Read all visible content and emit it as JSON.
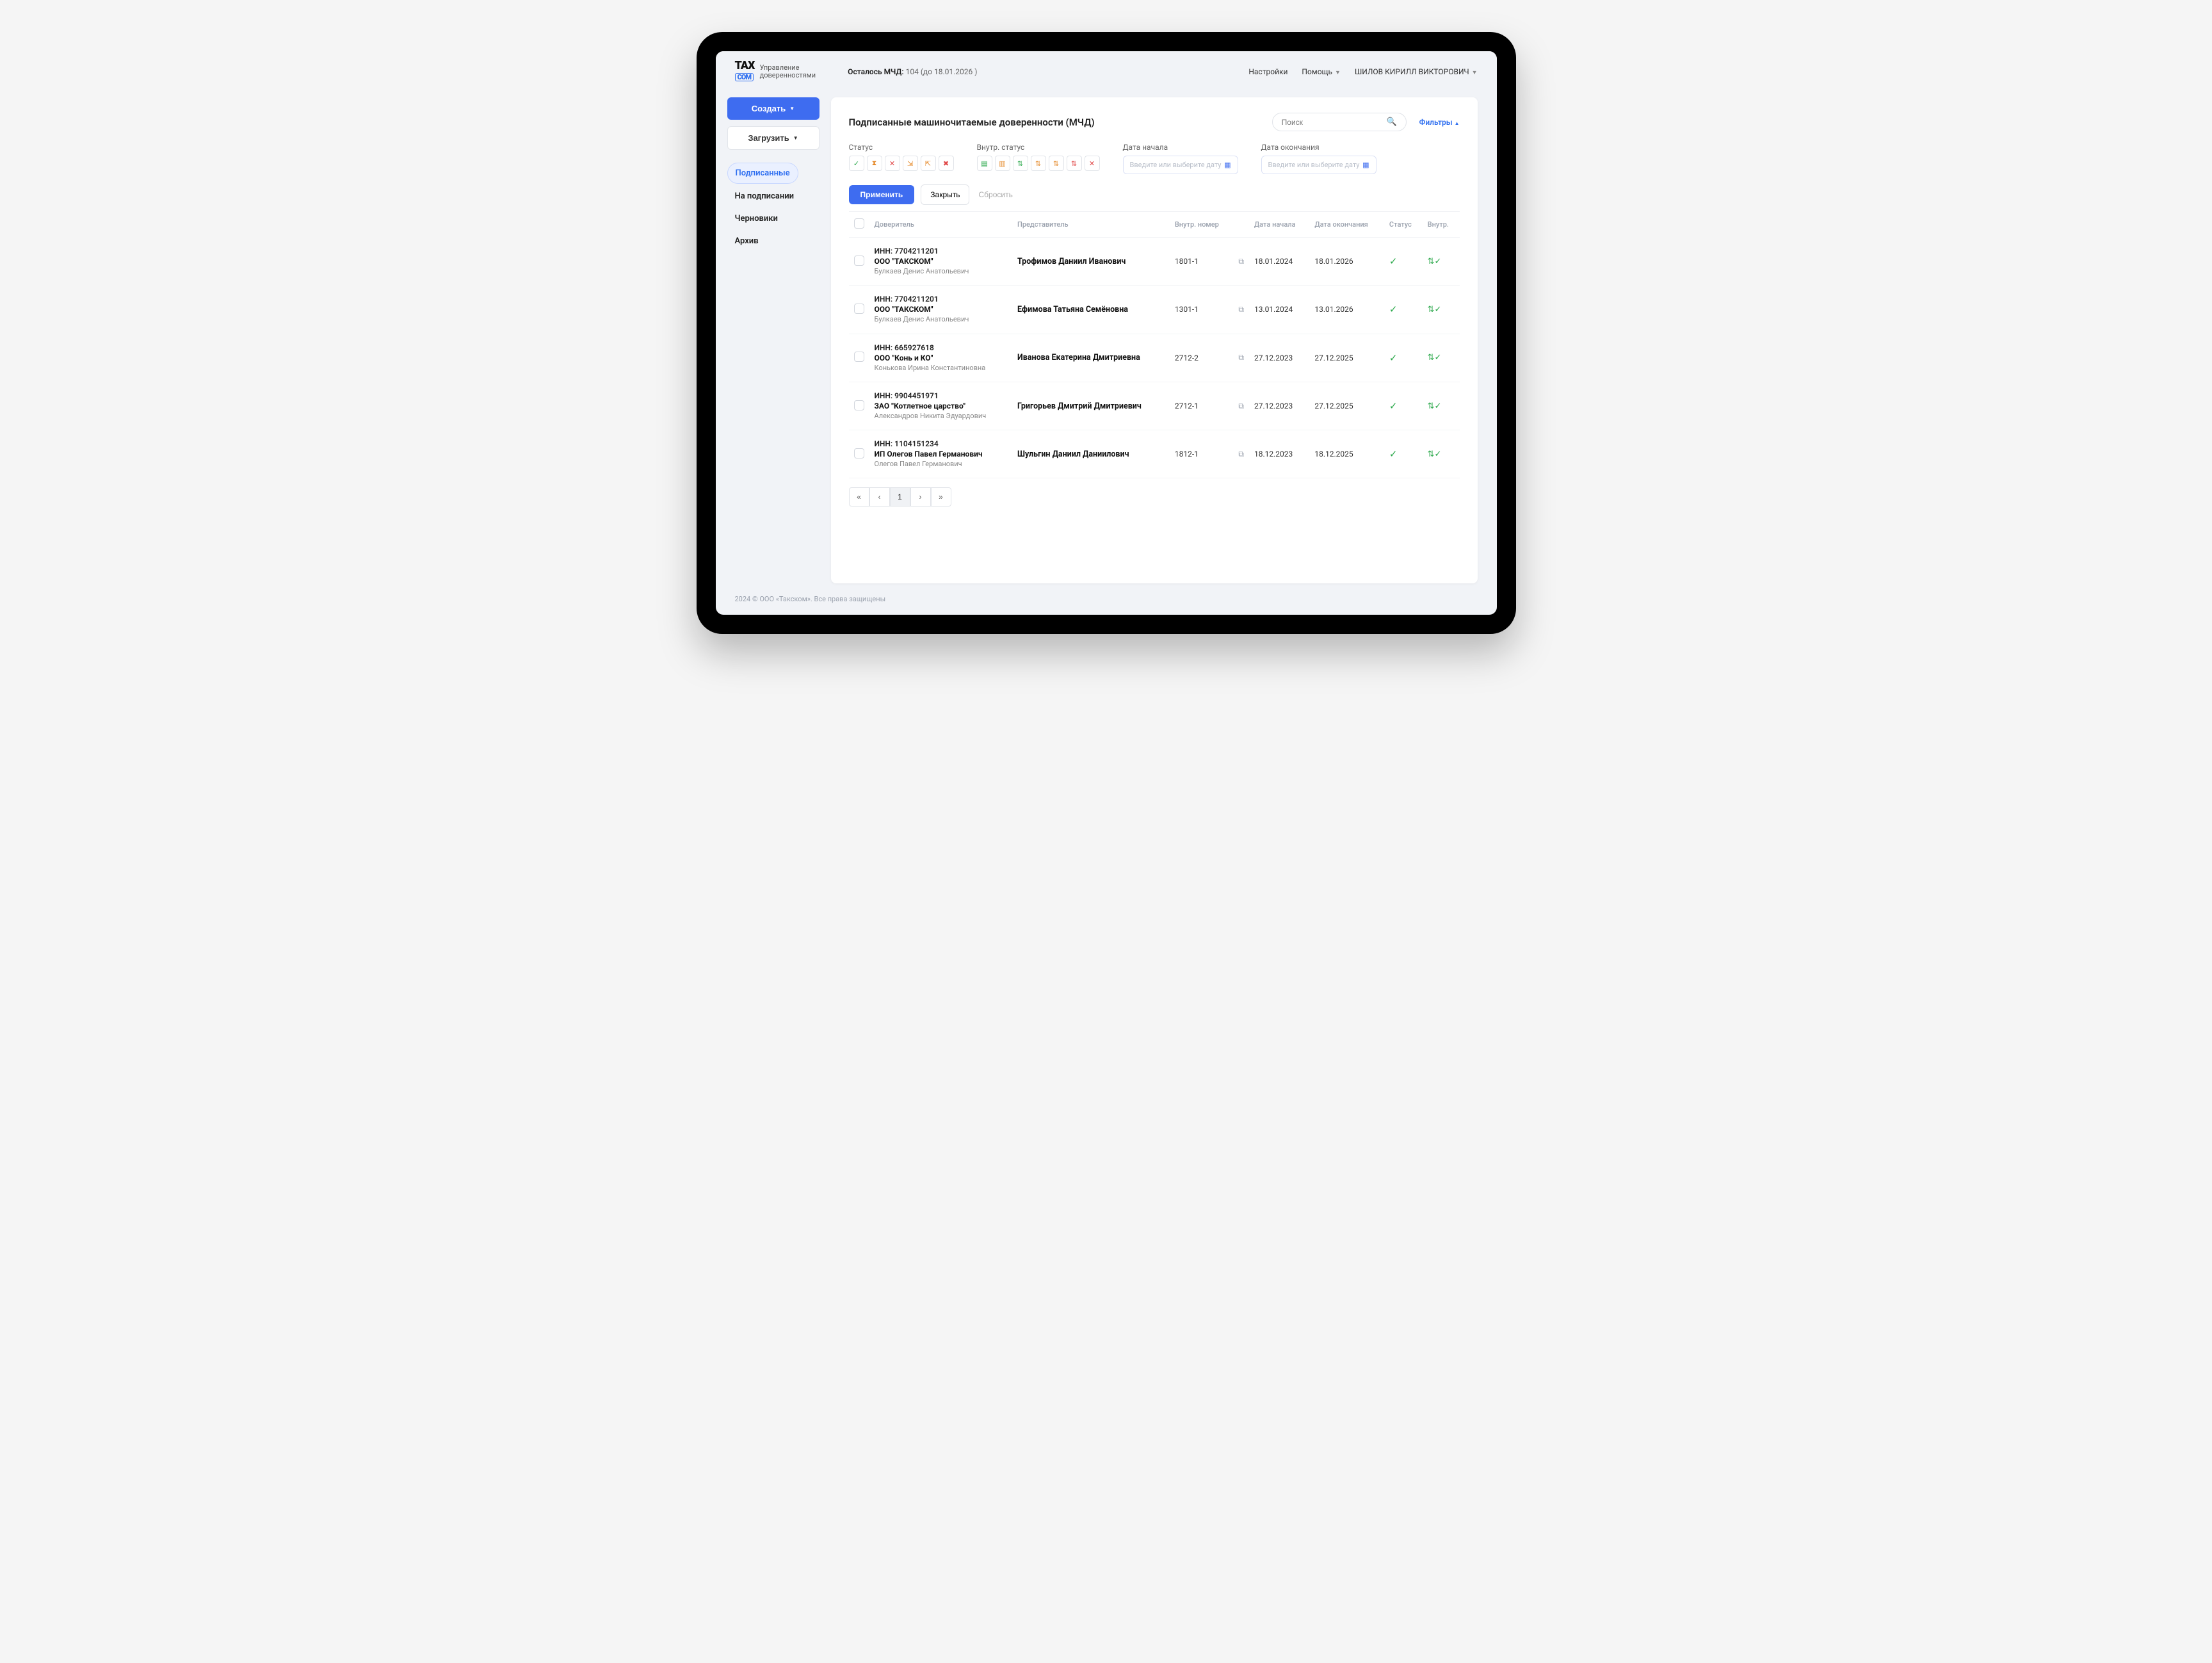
{
  "logo": {
    "top": "TAX",
    "bottom": "COM",
    "subtitle1": "Управление",
    "subtitle2": "доверенностями"
  },
  "remaining": {
    "label": "Осталось МЧД:",
    "value": "104 (до 18.01.2026 )"
  },
  "top_nav": {
    "settings": "Настройки",
    "help": "Помощь",
    "user": "ШИЛОВ КИРИЛЛ ВИКТОРОВИЧ"
  },
  "sidebar": {
    "create": "Создать",
    "upload": "Загрузить",
    "items": [
      "Подписанные",
      "На подписании",
      "Черновики",
      "Архив"
    ]
  },
  "page": {
    "title": "Подписанные машиночитаемые доверенности (МЧД)",
    "search_placeholder": "Поиск",
    "filters_toggle": "Фильтры"
  },
  "filters": {
    "status_label": "Статус",
    "int_status_label": "Внутр. статус",
    "start_label": "Дата начала",
    "end_label": "Дата окончания",
    "date_placeholder": "Введите или выберите дату",
    "apply": "Применить",
    "close": "Закрыть",
    "reset": "Сбросить"
  },
  "columns": {
    "doveritel": "Доверитель",
    "repr": "Представитель",
    "num": "Внутр. номер",
    "start": "Дата начала",
    "end": "Дата окончания",
    "status": "Статус",
    "int": "Внутр."
  },
  "rows": [
    {
      "inn": "ИНН: 7704211201",
      "org": "ООО \"ТАКСКОМ\"",
      "person": "Булкаев Денис Анатольевич",
      "repr": "Трофимов Даниил Иванович",
      "num": "1801-1",
      "start": "18.01.2024",
      "end": "18.01.2026"
    },
    {
      "inn": "ИНН: 7704211201",
      "org": "ООО \"ТАКСКОМ\"",
      "person": "Булкаев Денис Анатольевич",
      "repr": "Ефимова Татьяна Семёновна",
      "num": "1301-1",
      "start": "13.01.2024",
      "end": "13.01.2026"
    },
    {
      "inn": "ИНН: 665927618",
      "org": "ООО \"Конь и КО\"",
      "person": "Конькова Ирина Константиновна",
      "repr": "Иванова Екатерина Дмитриевна",
      "num": "2712-2",
      "start": "27.12.2023",
      "end": "27.12.2025"
    },
    {
      "inn": "ИНН: 9904451971",
      "org": "ЗАО \"Котлетное царство\"",
      "person": "Александров Никита Эдуардович",
      "repr": "Григорьев Дмитрий Дмитриевич",
      "num": "2712-1",
      "start": "27.12.2023",
      "end": "27.12.2025"
    },
    {
      "inn": "ИНН: 1104151234",
      "org": "ИП Олегов Павел Германович",
      "person": "Олегов Павел Германович",
      "repr": "Шульгин Даниил Даниилович",
      "num": "1812-1",
      "start": "18.12.2023",
      "end": "18.12.2025"
    }
  ],
  "pager": {
    "first": "«",
    "prev": "‹",
    "page": "1",
    "next": "›",
    "last": "»"
  },
  "footer": "2024 © ООО «Такском». Все права защищены"
}
